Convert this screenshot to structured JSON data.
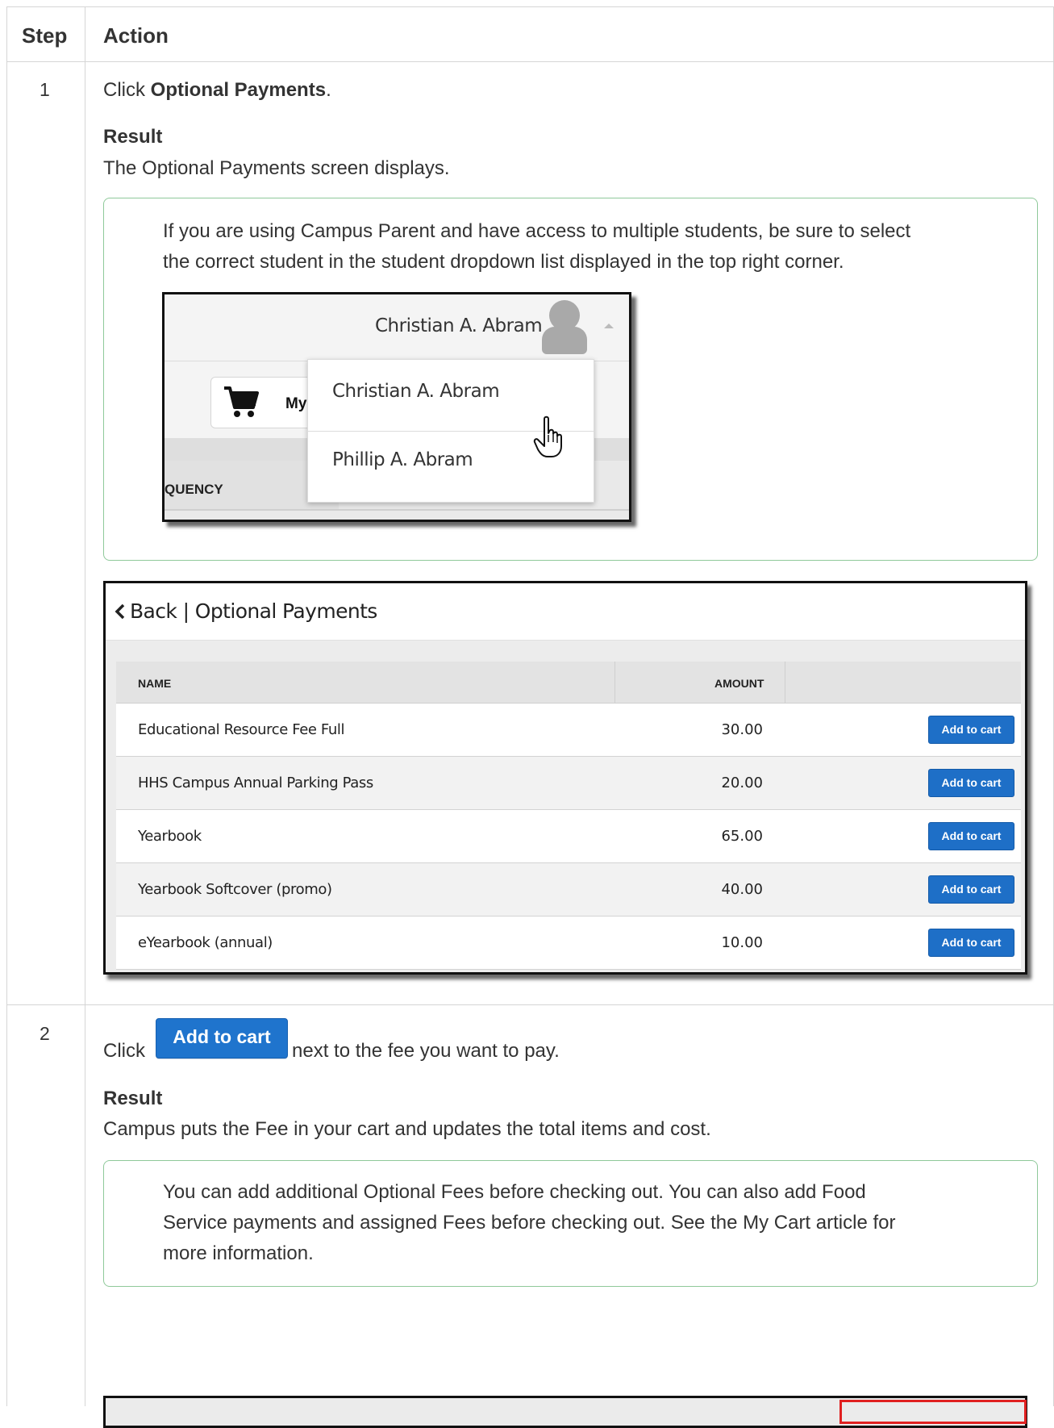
{
  "table_header": {
    "step": "Step",
    "action": "Action"
  },
  "steps": [
    {
      "number": "1",
      "instruction_prefix": "Click ",
      "instruction_bold": "Optional Payments",
      "instruction_suffix": ".",
      "result_label": "Result",
      "result_text": "The Optional Payments screen displays.",
      "note_lines": [
        "If you are using Campus Parent and have access to multiple students, be sure to select",
        "the correct student in the student dropdown list displayed in the top right corner."
      ],
      "student_dropdown_screenshot": {
        "selected_student": "Christian A. Abram",
        "cart_label": "My",
        "column_fragment": "QUENCY",
        "options": [
          "Christian A. Abram",
          "Phillip A. Abram"
        ]
      },
      "optional_payments_screenshot": {
        "back_title": "Back | Optional Payments",
        "columns": [
          "NAME",
          "AMOUNT"
        ],
        "rows": [
          {
            "name": "Educational Resource Fee Full",
            "amount": "30.00",
            "button": "Add to cart"
          },
          {
            "name": "HHS Campus Annual Parking Pass",
            "amount": "20.00",
            "button": "Add to cart"
          },
          {
            "name": "Yearbook",
            "amount": "65.00",
            "button": "Add to cart"
          },
          {
            "name": "Yearbook Softcover (promo)",
            "amount": "40.00",
            "button": "Add to cart"
          },
          {
            "name": "eYearbook (annual)",
            "amount": "10.00",
            "button": "Add to cart"
          }
        ]
      }
    },
    {
      "number": "2",
      "instruction_prefix": "Click",
      "inline_button": "Add to cart",
      "instruction_suffix": "next to the fee you want to pay.",
      "result_label": "Result",
      "result_text": "Campus puts the Fee in your cart and updates the total items and cost.",
      "note_lines": [
        "You can add additional Optional Fees before checking out. You can also add Food",
        "Service payments and assigned Fees before checking out. See the My Cart article for",
        "more information."
      ]
    }
  ],
  "colors": {
    "button_blue": "#1e6fc7",
    "note_border": "#8fc99a",
    "highlight_red": "#e02020"
  }
}
